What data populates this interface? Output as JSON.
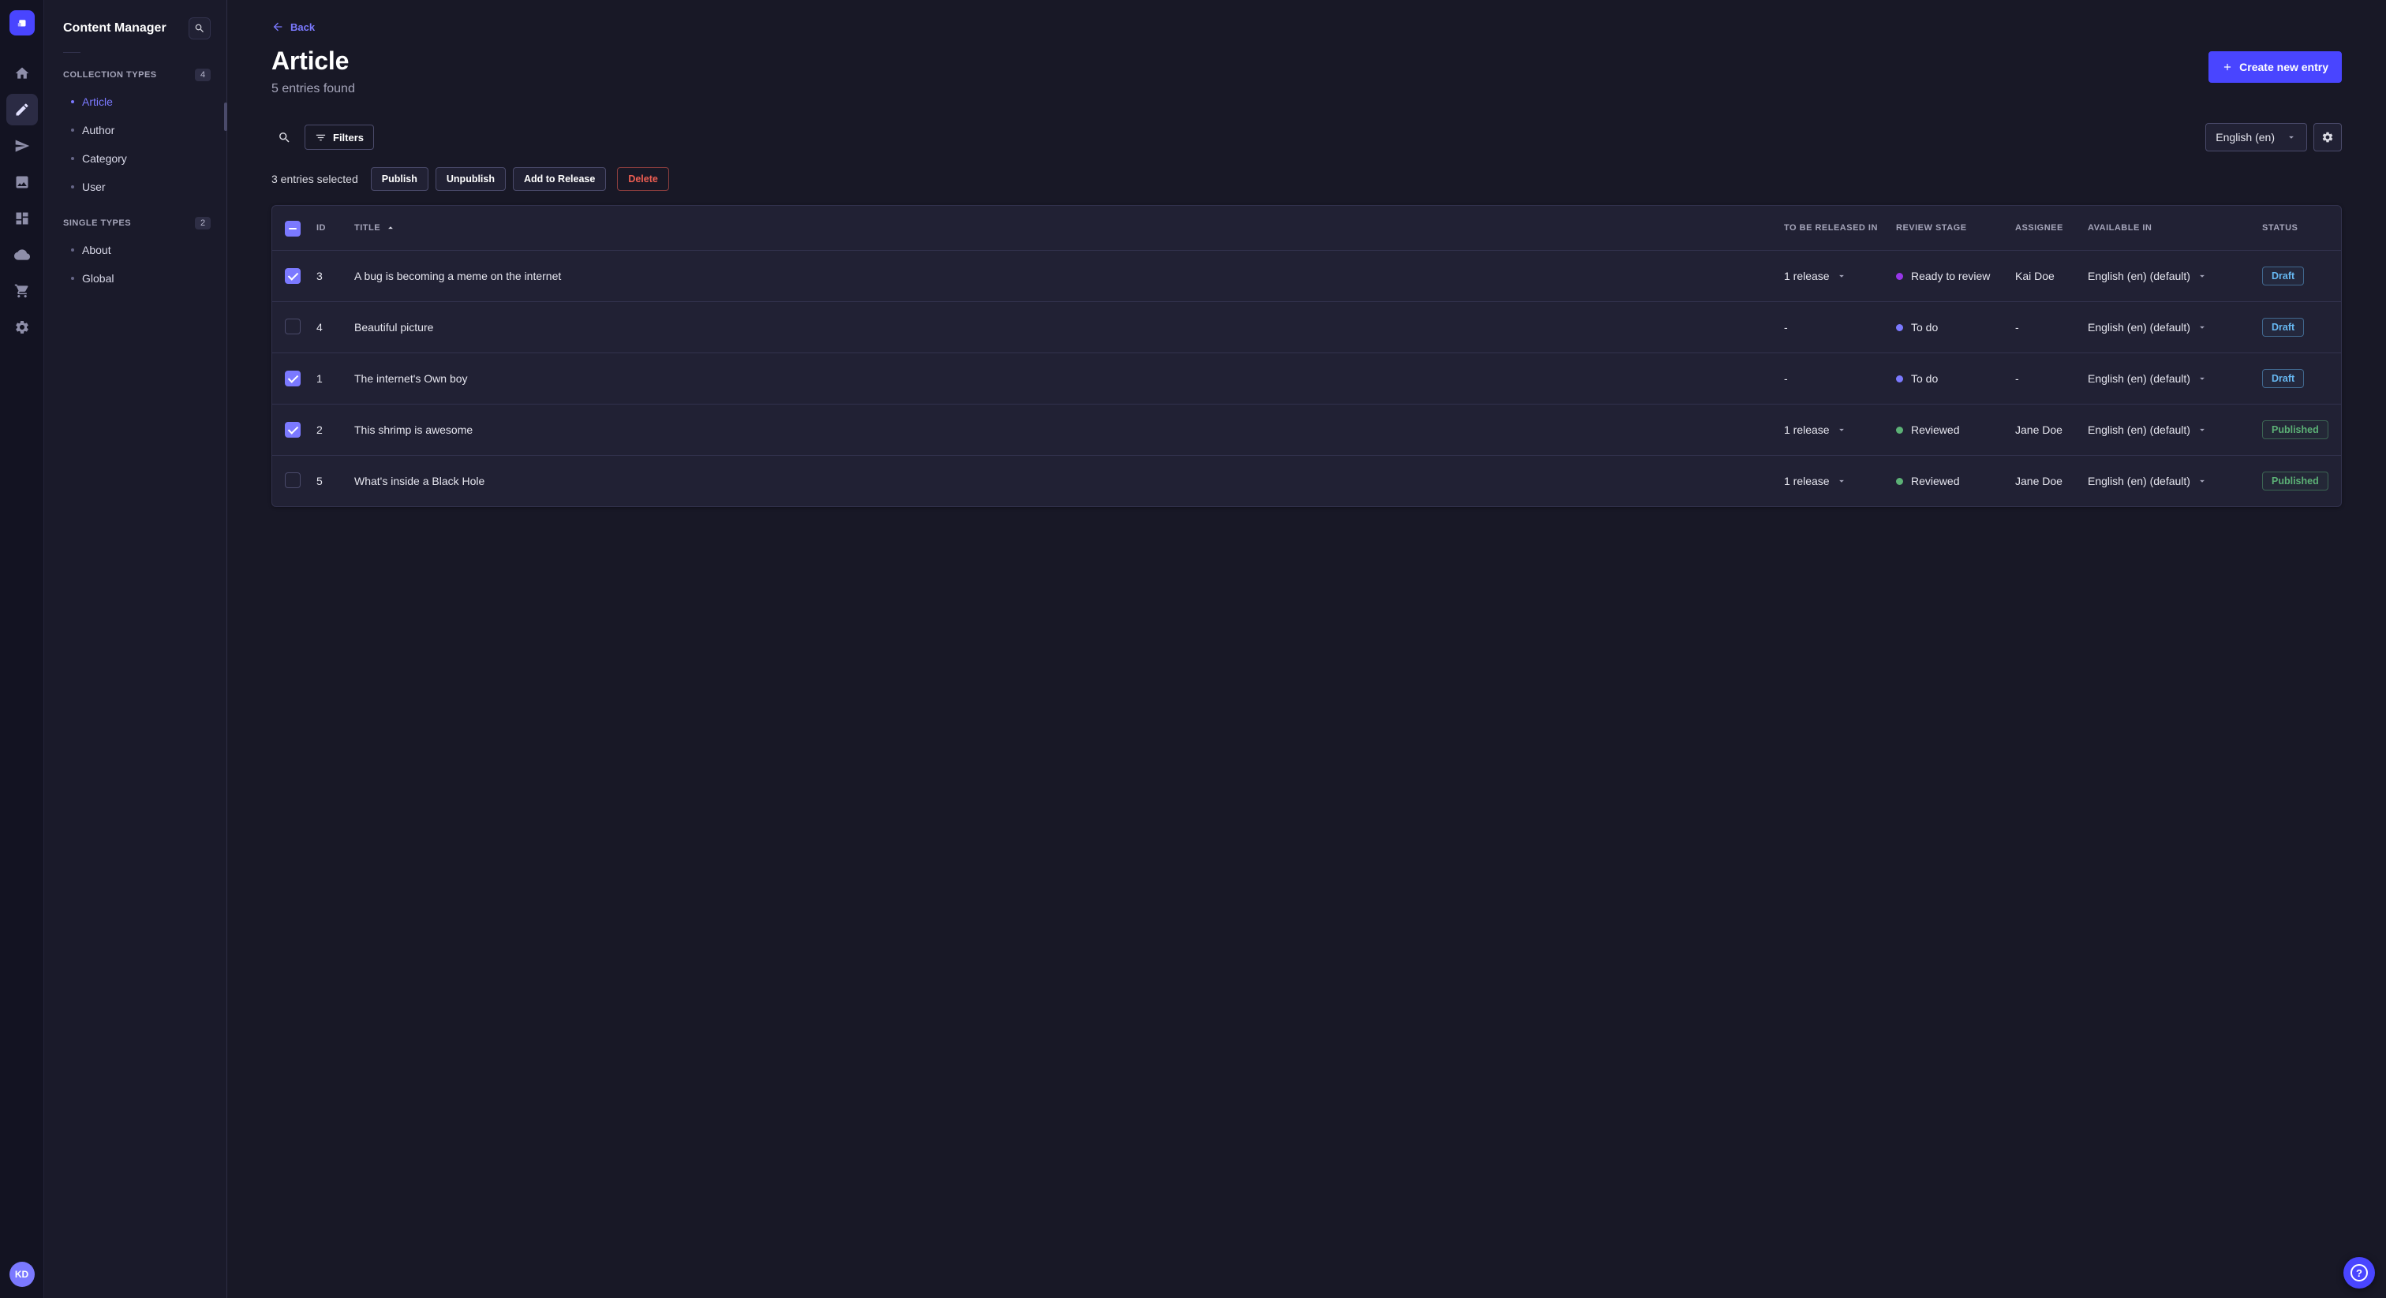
{
  "colors": {
    "accent": "#4945ff",
    "accent_light": "#7b79ff",
    "draft_status": "#66b7f1",
    "published_status": "#5cb176",
    "danger": "#ee5e52"
  },
  "nav_rail": {
    "logo": "strapi-logo",
    "items": [
      {
        "icon": "home-icon",
        "active": false
      },
      {
        "icon": "content-manager-pen-icon",
        "active": true
      },
      {
        "icon": "releases-paper-plane-icon",
        "active": false
      },
      {
        "icon": "media-library-icon",
        "active": false
      },
      {
        "icon": "content-type-builder-icon",
        "active": false
      },
      {
        "icon": "deploy-cloud-icon",
        "active": false
      },
      {
        "icon": "marketplace-cart-icon",
        "active": false
      },
      {
        "icon": "settings-gear-icon",
        "active": false
      }
    ],
    "avatar_initials": "KD"
  },
  "sidebar": {
    "title": "Content Manager",
    "search_icon": "search-icon",
    "sections": [
      {
        "label": "COLLECTION TYPES",
        "badge": "4",
        "items": [
          {
            "label": "Article",
            "active": true
          },
          {
            "label": "Author",
            "active": false
          },
          {
            "label": "Category",
            "active": false
          },
          {
            "label": "User",
            "active": false
          }
        ]
      },
      {
        "label": "SINGLE TYPES",
        "badge": "2",
        "items": [
          {
            "label": "About",
            "active": false
          },
          {
            "label": "Global",
            "active": false
          }
        ]
      }
    ]
  },
  "header": {
    "back_label": "Back",
    "title": "Article",
    "subtitle": "5 entries found",
    "create_button_label": "Create new entry"
  },
  "toolbar": {
    "search_icon": "search-icon",
    "filters_label": "Filters",
    "filters_icon": "filter-icon",
    "locale_value": "English (en)",
    "configure_icon": "gear-icon"
  },
  "selection_bar": {
    "selected_text": "3 entries selected",
    "publish_label": "Publish",
    "unpublish_label": "Unpublish",
    "add_to_release_label": "Add to Release",
    "delete_label": "Delete"
  },
  "table": {
    "headers": {
      "id": "ID",
      "title": "TITLE",
      "to_be_released_in": "TO BE RELEASED IN",
      "review_stage": "REVIEW STAGE",
      "assignee": "ASSIGNEE",
      "available_in": "AVAILABLE IN",
      "status": "STATUS"
    },
    "sort": {
      "column": "TITLE",
      "direction": "ascending"
    },
    "rows": [
      {
        "checked": true,
        "id": "3",
        "title": "A bug is becoming a meme on the internet",
        "release": "1 release",
        "has_release_dropdown": true,
        "review_stage": "Ready to review",
        "review_dot_color": "#9736e8",
        "assignee": "Kai Doe",
        "available_in": "English (en) (default)",
        "status": "Draft"
      },
      {
        "checked": false,
        "id": "4",
        "title": "Beautiful picture",
        "release": "-",
        "has_release_dropdown": false,
        "review_stage": "To do",
        "review_dot_color": "#7b79ff",
        "assignee": "-",
        "available_in": "English (en) (default)",
        "status": "Draft"
      },
      {
        "checked": true,
        "id": "1",
        "title": "The internet's Own boy",
        "release": "-",
        "has_release_dropdown": false,
        "review_stage": "To do",
        "review_dot_color": "#7b79ff",
        "assignee": "-",
        "available_in": "English (en) (default)",
        "status": "Draft"
      },
      {
        "checked": true,
        "id": "2",
        "title": "This shrimp is awesome",
        "release": "1 release",
        "has_release_dropdown": true,
        "review_stage": "Reviewed",
        "review_dot_color": "#5cb176",
        "assignee": "Jane Doe",
        "available_in": "English (en) (default)",
        "status": "Published"
      },
      {
        "checked": false,
        "id": "5",
        "title": "What's inside a Black Hole",
        "release": "1 release",
        "has_release_dropdown": true,
        "review_stage": "Reviewed",
        "review_dot_color": "#5cb176",
        "assignee": "Jane Doe",
        "available_in": "English (en) (default)",
        "status": "Published"
      }
    ]
  },
  "help_button": {
    "label": "?"
  }
}
